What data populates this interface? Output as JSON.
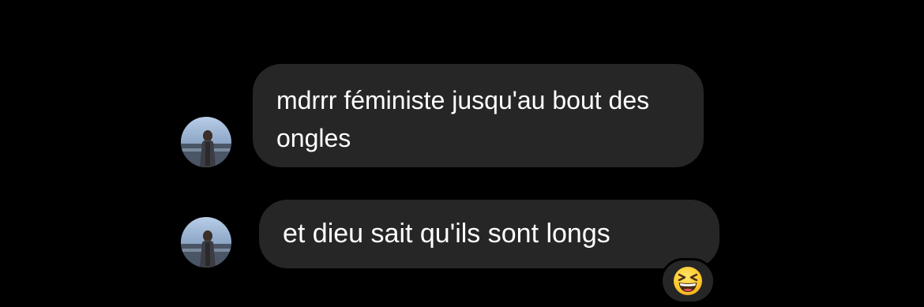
{
  "colors": {
    "background": "#000000",
    "bubble": "#262626",
    "text": "#ffffff"
  },
  "messages": [
    {
      "sender_avatar": "avatar-photo",
      "text": "mdrrr féministe jusqu'au bout des ongles"
    },
    {
      "sender_avatar": "avatar-photo",
      "text": "et dieu sait qu'ils sont longs",
      "reaction": "grinning-squinting-face-emoji"
    }
  ]
}
